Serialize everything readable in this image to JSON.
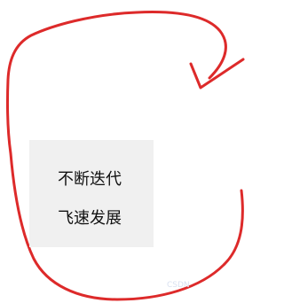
{
  "text_box": {
    "line_1": "不断迭代",
    "line_2": "飞速发展"
  },
  "watermark": {
    "text": "CSDN"
  },
  "colors": {
    "arrow_stroke": "#dd2a2a",
    "box_background": "#f0f0f0",
    "text": "#111111"
  },
  "icons": {
    "main_shape": "red-circular-arrow-icon"
  }
}
